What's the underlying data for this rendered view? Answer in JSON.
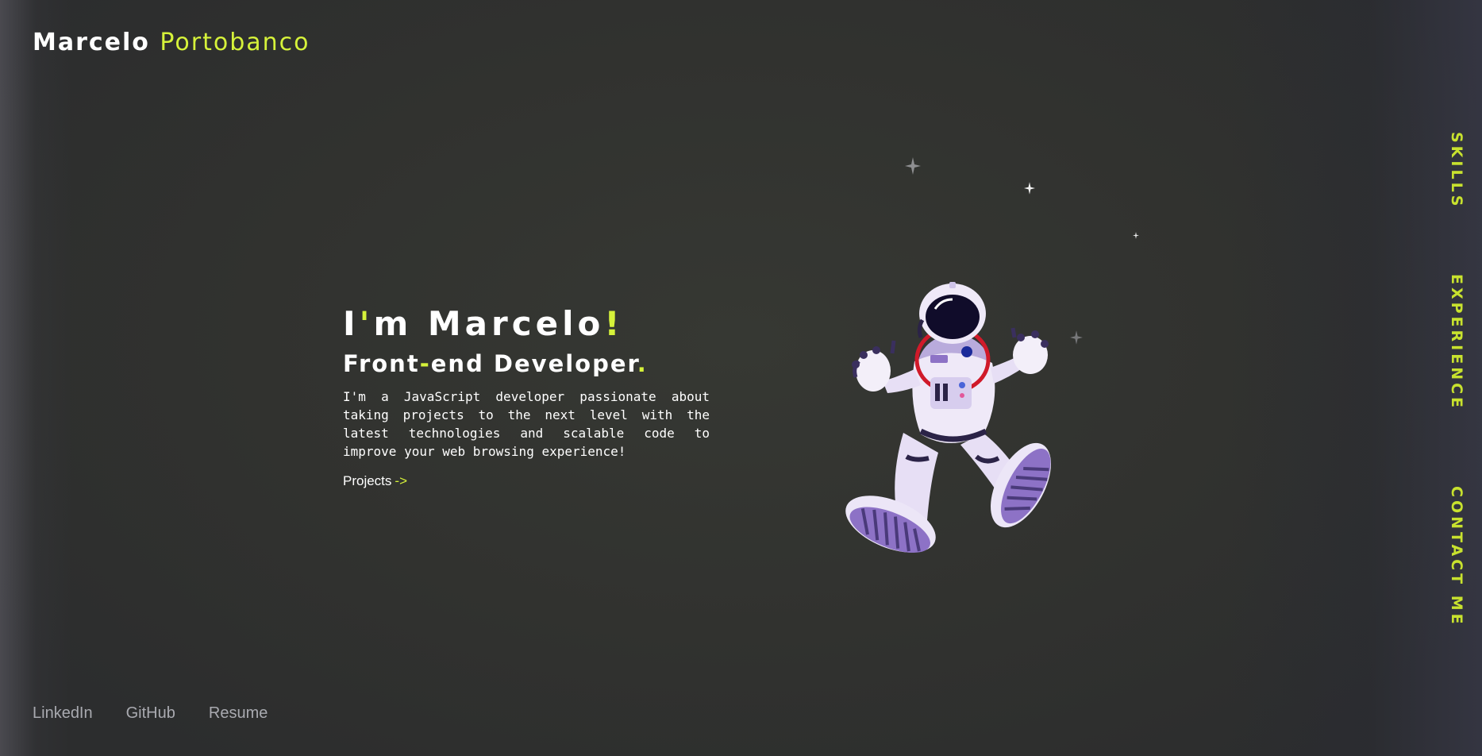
{
  "logo": {
    "first": "Marcelo",
    "last": "Portobanco"
  },
  "hero": {
    "title_part1": "I",
    "title_apostrophe": "'",
    "title_part2": "m Marcelo",
    "title_excl": "!",
    "subtitle_part1": "Front",
    "subtitle_dash": "-",
    "subtitle_part2": "end Developer",
    "subtitle_dot": ".",
    "description": "I'm a JavaScript developer passionate about taking projects to the next level with the latest technologies and scalable code to improve your web browsing experience!",
    "projects_label": "Projects",
    "projects_arrow": "->"
  },
  "nav": {
    "skills": "SKILLS",
    "experience": "EXPERIENCE",
    "contact": "CONTACT ME"
  },
  "social": {
    "linkedin": "LinkedIn",
    "github": "GitHub",
    "resume": "Resume"
  },
  "colors": {
    "accent": "#d6f23a",
    "background": "#30322f",
    "astronaut_suit": "#e6ddf6",
    "astronaut_accent": "#8b6cc9"
  },
  "icons": [
    "star-sparkle-icon",
    "astronaut-illustration"
  ]
}
